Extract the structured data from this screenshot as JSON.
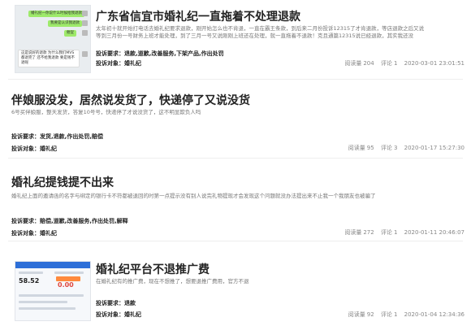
{
  "complaints": [
    {
      "title": "广东省信宜市婚礼纪一直拖着不处理退款",
      "summary_lines": [
        "太年初十就开始打电话去婚礼纪要求退款，刚开始怎么也不肯退，一直在霸王条款，到后来二月份投诉12315了才肯退款，等店退款之后又说",
        "等到三月份一号财务上班才能处理，到了三月一号又说刚刚上班还在处理，就一直拖着不退款！克且通篇12315说已经退款，其实我还没"
      ],
      "demand_label": "投诉要求：",
      "demand_value": "退款,道歉,改善服务,下架产品,作出处罚",
      "target_label": "投诉对象：",
      "target_value": "婚礼纪",
      "views_label": "阅读量",
      "views": "204",
      "comments_label": "评论",
      "comments": "1",
      "timestamp": "2020-03-01 23:01:51",
      "chat": [
        "婚礼纪一你说什么时候给我退款",
        "我要是认识我退款",
        "催促",
        "这是说好的退款 为什么我们MVS都退完了 还不给我退款 要是钱不退呢"
      ]
    },
    {
      "title": "伴娘服没发，居然说发货了，快递停了又说没货",
      "summary_lines": [
        "6号买伴娘服，整天发货，答复10号号，快递停了才说没货了，这不明显欺负人吗"
      ],
      "demand_label": "投诉要求：",
      "demand_value": "发货,退款,作出处罚,赔偿",
      "target_label": "投诉对象：",
      "target_value": "婚礼纪",
      "views_label": "阅读量",
      "views": "95",
      "comments_label": "评论",
      "comments": "3",
      "timestamp": "2020-01-17 15:27:30"
    },
    {
      "title": "婚礼纪提钱提不出来",
      "summary_lines": [
        "婚礼纪上面的邀请函的名字与绑定的银行卡不符都被退回的时第一点提示没有别人说完礼物提现才会发现这个问题就没办法提出来不止我一个我朋友也被骗了"
      ],
      "demand_label": "投诉要求：",
      "demand_value": "赔偿,道歉,改善服务,作出处罚,解释",
      "target_label": "投诉对象：",
      "target_value": "婚礼纪",
      "views_label": "阅读量",
      "views": "272",
      "comments_label": "评论",
      "comments": "1",
      "timestamp": "2020-01-11 20:46:07"
    },
    {
      "title": "婚礼纪平台不退推广费",
      "summary_lines": [
        "在婚礼纪有的推广费，现在不想推了，想要退推广费用，官方不退"
      ],
      "demand_label": "投诉要求：",
      "demand_value": "退款",
      "target_label": "投诉对象：",
      "target_value": "婚礼纪",
      "views_label": "阅读量",
      "views": "92",
      "comments_label": "评论",
      "comments": "1",
      "timestamp": "2020-01-04 12:34:36",
      "thumb_values": [
        "58.52",
        "0.00"
      ]
    }
  ]
}
